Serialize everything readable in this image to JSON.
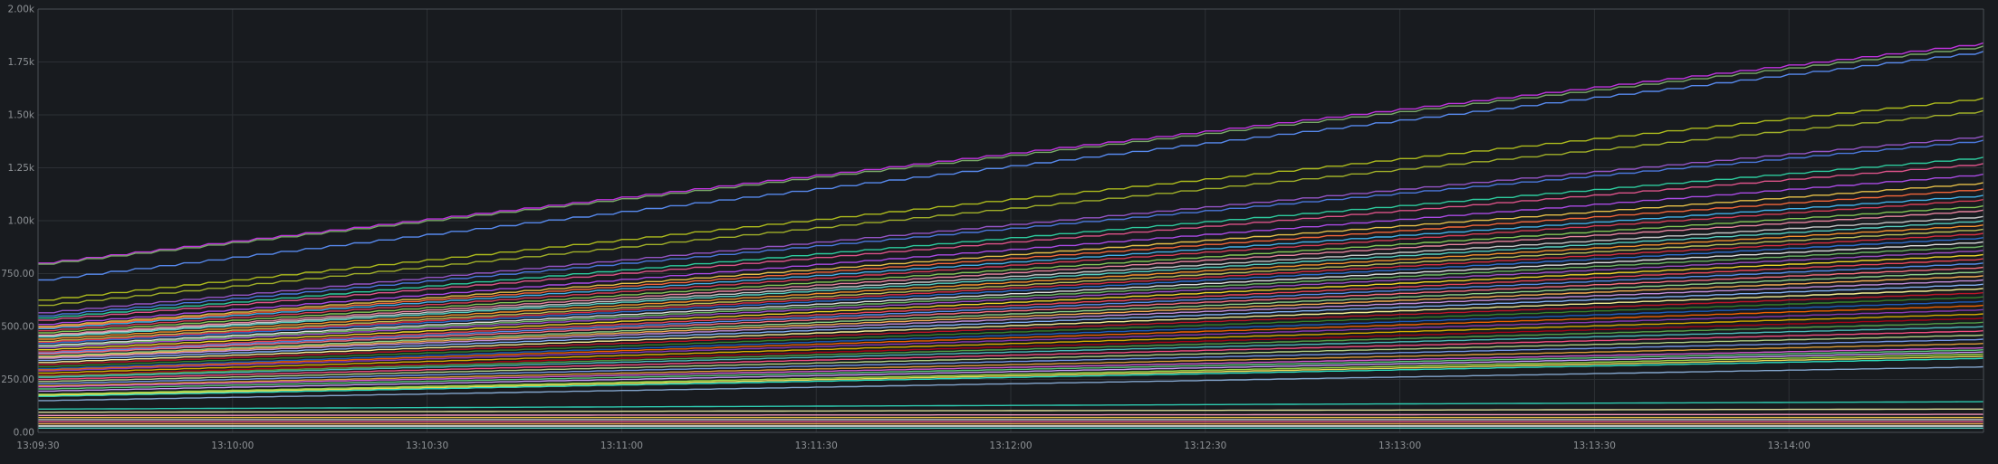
{
  "chart_data": {
    "type": "line",
    "title": "",
    "xlabel": "",
    "ylabel": "",
    "ylim": [
      0,
      2000
    ],
    "y_ticks": [
      {
        "value": 0,
        "label": "0.00"
      },
      {
        "value": 250,
        "label": "250.00"
      },
      {
        "value": 500,
        "label": "500.00"
      },
      {
        "value": 750,
        "label": "750.00"
      },
      {
        "value": 1000,
        "label": "1.00k"
      },
      {
        "value": 1250,
        "label": "1.25k"
      },
      {
        "value": 1500,
        "label": "1.50k"
      },
      {
        "value": 1750,
        "label": "1.75k"
      },
      {
        "value": 2000,
        "label": "2.00k"
      }
    ],
    "xlim": [
      "13:09:30",
      "13:14:30"
    ],
    "x_ticks": [
      "13:09:30",
      "13:10:00",
      "13:10:30",
      "13:11:00",
      "13:11:30",
      "13:12:00",
      "13:12:30",
      "13:13:00",
      "13:13:30",
      "13:14:00"
    ],
    "grid": true,
    "legend": "none",
    "x": [
      "13:09:30",
      "13:14:30"
    ],
    "series": [
      {
        "values": [
          800,
          1840
        ],
        "color": "#c836e8"
      },
      {
        "values": [
          795,
          1825
        ],
        "color": "#7eb26d"
      },
      {
        "values": [
          720,
          1800
        ],
        "color": "#5b8ff9"
      },
      {
        "values": [
          625,
          1580
        ],
        "color": "#b5c41d"
      },
      {
        "values": [
          600,
          1520
        ],
        "color": "#a9b82a"
      },
      {
        "values": [
          565,
          1400
        ],
        "color": "#9b59d0"
      },
      {
        "values": [
          550,
          1380
        ],
        "color": "#4e7de8"
      },
      {
        "values": [
          540,
          1300
        ],
        "color": "#2fd5a5"
      },
      {
        "values": [
          530,
          1270
        ],
        "color": "#e8568f"
      },
      {
        "values": [
          510,
          1220
        ],
        "color": "#b34ef0"
      },
      {
        "values": [
          500,
          1180
        ],
        "color": "#f2c94c"
      },
      {
        "values": [
          495,
          1150
        ],
        "color": "#ff6b3d"
      },
      {
        "values": [
          490,
          1120
        ],
        "color": "#44b8f2"
      },
      {
        "values": [
          480,
          1100
        ],
        "color": "#e0405a"
      },
      {
        "values": [
          470,
          1070
        ],
        "color": "#8ad05a"
      },
      {
        "values": [
          460,
          1050
        ],
        "color": "#f28aa5"
      },
      {
        "values": [
          455,
          1020
        ],
        "color": "#d0d0d0"
      },
      {
        "values": [
          450,
          1000
        ],
        "color": "#5ad8c8"
      },
      {
        "values": [
          440,
          980
        ],
        "color": "#ff9830"
      },
      {
        "values": [
          430,
          960
        ],
        "color": "#c8c85a"
      },
      {
        "values": [
          425,
          940
        ],
        "color": "#e02f44"
      },
      {
        "values": [
          420,
          920
        ],
        "color": "#3274d9"
      },
      {
        "values": [
          410,
          900
        ],
        "color": "#e8e8e8"
      },
      {
        "values": [
          405,
          880
        ],
        "color": "#73bf69"
      },
      {
        "values": [
          400,
          860
        ],
        "color": "#a352cc"
      },
      {
        "values": [
          390,
          840
        ],
        "color": "#fade2a"
      },
      {
        "values": [
          380,
          820
        ],
        "color": "#f2495c"
      },
      {
        "values": [
          375,
          800
        ],
        "color": "#5794f2"
      },
      {
        "values": [
          370,
          780
        ],
        "color": "#ff7383"
      },
      {
        "values": [
          360,
          760
        ],
        "color": "#96d98d"
      },
      {
        "values": [
          355,
          740
        ],
        "color": "#ffb357"
      },
      {
        "values": [
          350,
          720
        ],
        "color": "#ca95e5"
      },
      {
        "values": [
          340,
          700
        ],
        "color": "#8ab8ff"
      },
      {
        "values": [
          330,
          680
        ],
        "color": "#fff899"
      },
      {
        "values": [
          320,
          660
        ],
        "color": "#c4162a"
      },
      {
        "values": [
          310,
          640
        ],
        "color": "#37872d"
      },
      {
        "values": [
          300,
          620
        ],
        "color": "#1f60c4"
      },
      {
        "values": [
          295,
          600
        ],
        "color": "#fa6400"
      },
      {
        "values": [
          290,
          580
        ],
        "color": "#8f3bb8"
      },
      {
        "values": [
          280,
          560
        ],
        "color": "#e0b400"
      },
      {
        "values": [
          270,
          540
        ],
        "color": "#ad0317"
      },
      {
        "values": [
          265,
          520
        ],
        "color": "#56a64b"
      },
      {
        "values": [
          260,
          500
        ],
        "color": "#4fc3c3"
      },
      {
        "values": [
          250,
          480
        ],
        "color": "#ff5286"
      },
      {
        "values": [
          240,
          460
        ],
        "color": "#b8d98a"
      },
      {
        "values": [
          230,
          440
        ],
        "color": "#7a9cf0"
      },
      {
        "values": [
          220,
          420
        ],
        "color": "#e8a33c"
      },
      {
        "values": [
          215,
          400
        ],
        "color": "#d95fd9"
      },
      {
        "values": [
          205,
          390
        ],
        "color": "#60d080"
      },
      {
        "values": [
          195,
          380
        ],
        "color": "#cfa0ff"
      },
      {
        "values": [
          180,
          370
        ],
        "color": "#9ee04a"
      },
      {
        "values": [
          175,
          360
        ],
        "color": "#f5e35a"
      },
      {
        "values": [
          170,
          350
        ],
        "color": "#2ee8c8"
      },
      {
        "values": [
          150,
          310
        ],
        "color": "#8aaed8"
      },
      {
        "values": [
          110,
          145
        ],
        "color": "#2fd5b8"
      },
      {
        "values": [
          95,
          110
        ],
        "color": "#e8e8a0"
      },
      {
        "values": [
          80,
          85
        ],
        "color": "#ff9cc6"
      },
      {
        "values": [
          70,
          70
        ],
        "color": "#f2c94c"
      },
      {
        "values": [
          60,
          60
        ],
        "color": "#c8c8c8"
      },
      {
        "values": [
          50,
          50
        ],
        "color": "#e8568f"
      },
      {
        "values": [
          40,
          40
        ],
        "color": "#ffb357"
      },
      {
        "values": [
          30,
          30
        ],
        "color": "#ffffff"
      },
      {
        "values": [
          20,
          20
        ],
        "color": "#5ad8c8"
      }
    ]
  },
  "style": {
    "background": "#181b1f",
    "plot_background": "#181b1f",
    "grid_color": "#2c3035",
    "axis_color": "#4a4f55",
    "tick_label_color": "#8e9296"
  }
}
